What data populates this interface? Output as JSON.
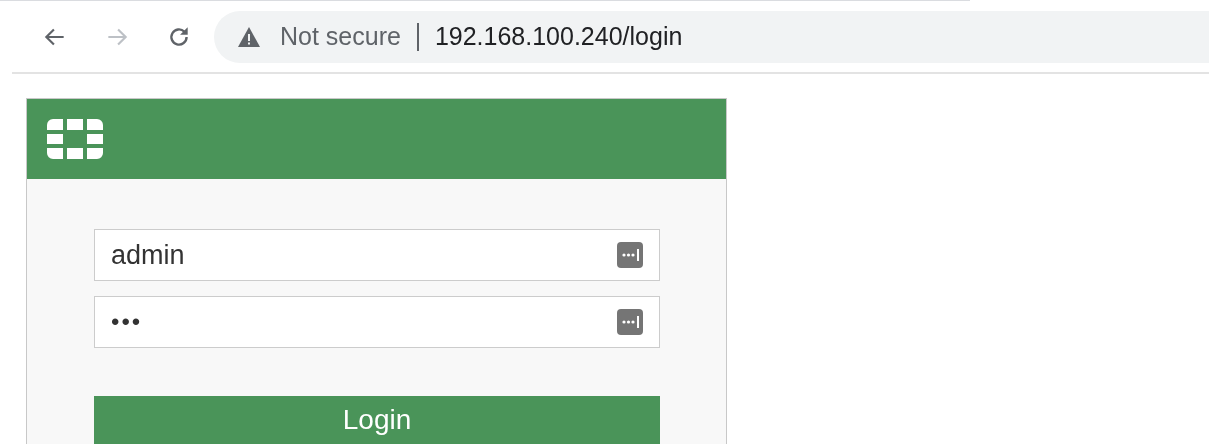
{
  "browser": {
    "security_label": "Not secure",
    "url": "192.168.100.240/login",
    "back_enabled": true,
    "forward_enabled": false
  },
  "login_form": {
    "fields": [
      {
        "kind": "text",
        "value": "admin"
      },
      {
        "kind": "password",
        "value": "•••"
      }
    ],
    "button": "Login"
  }
}
